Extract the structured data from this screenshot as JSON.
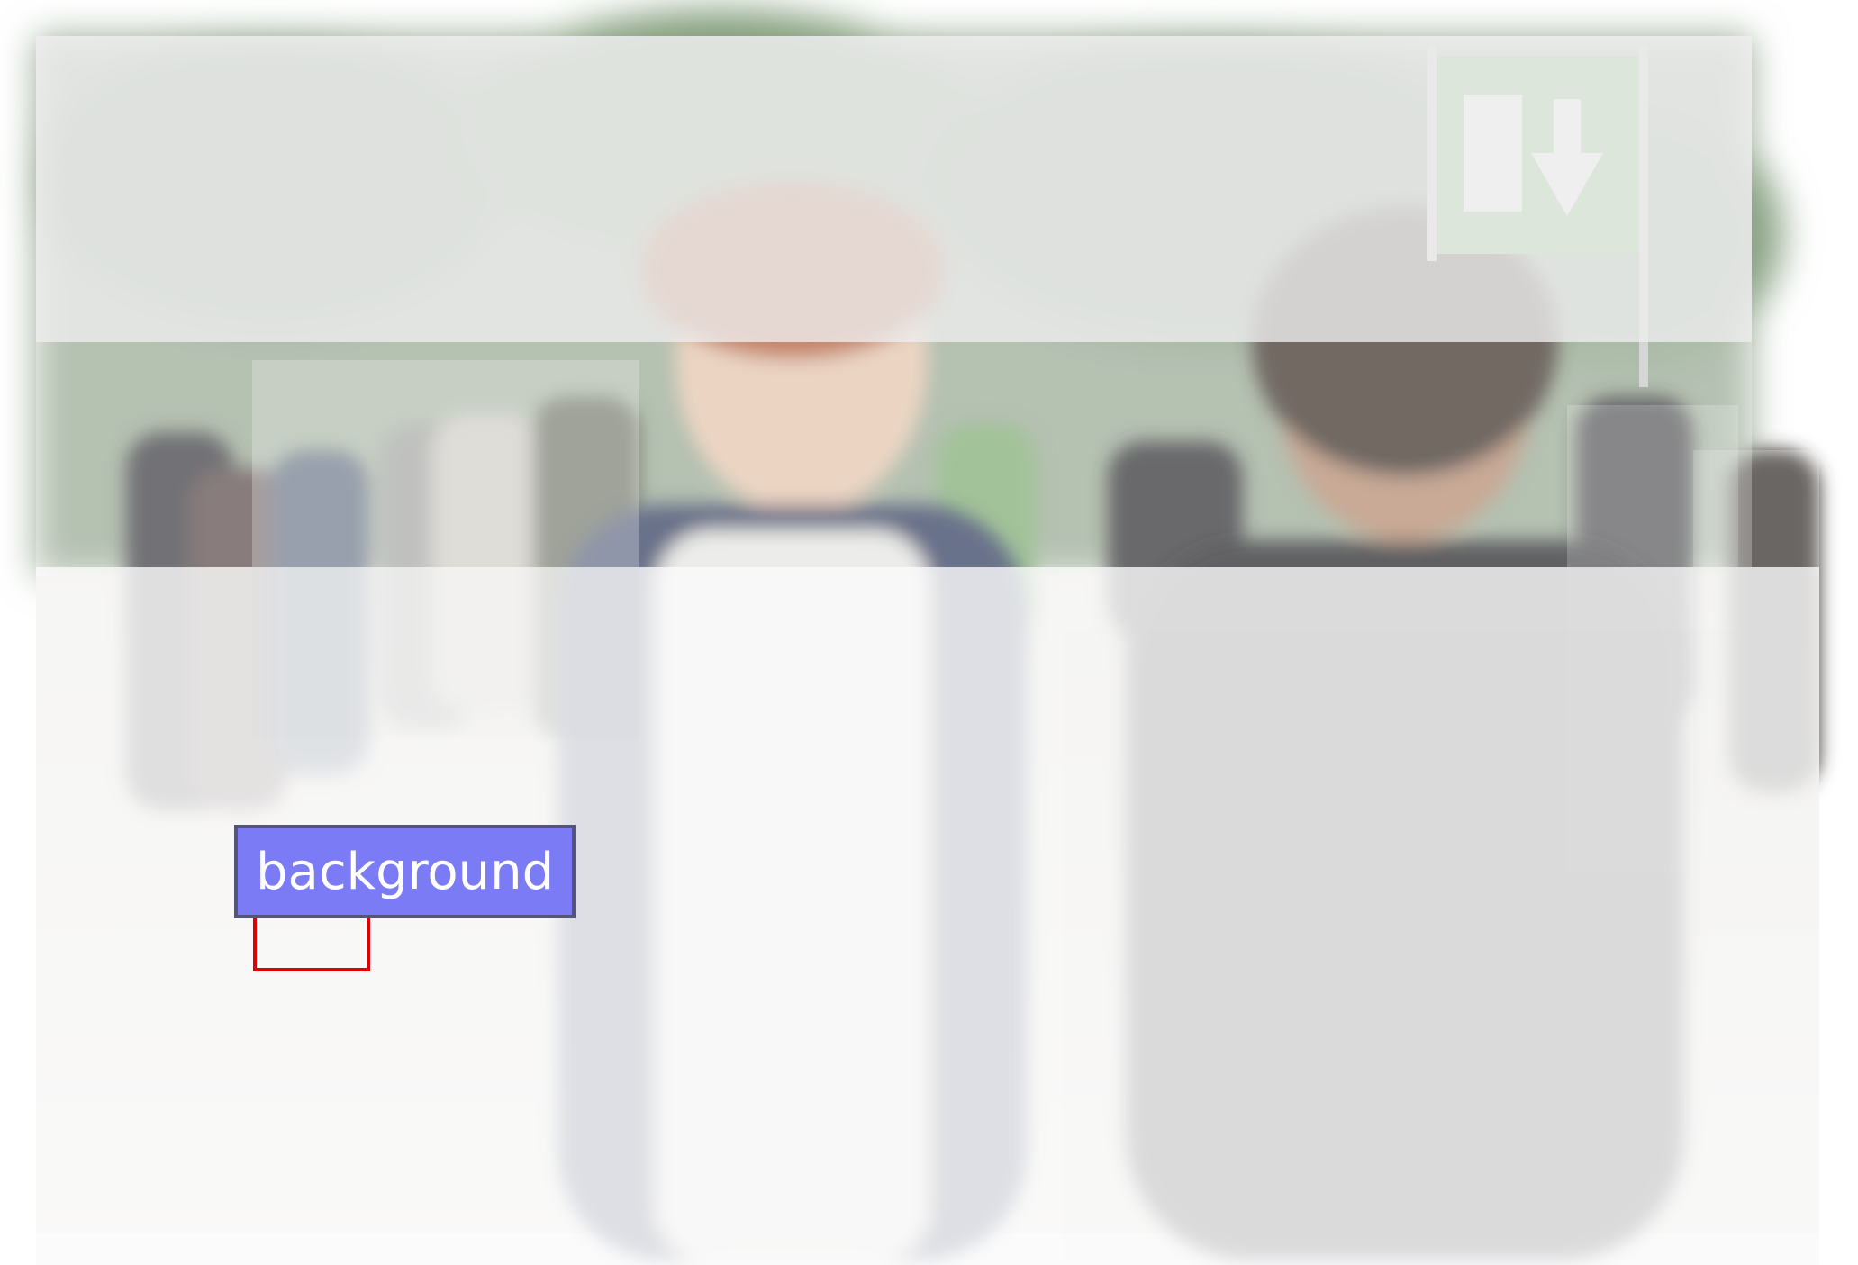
{
  "annotation": {
    "label": "background",
    "label_box_color": "#7b7bf5",
    "label_border_color": "#55557a",
    "highlight_color": "#e00000"
  },
  "scene": {
    "sign_color": "#6fb56a",
    "foliage_color": "#8aa383",
    "wash_color": "#ffffff"
  }
}
